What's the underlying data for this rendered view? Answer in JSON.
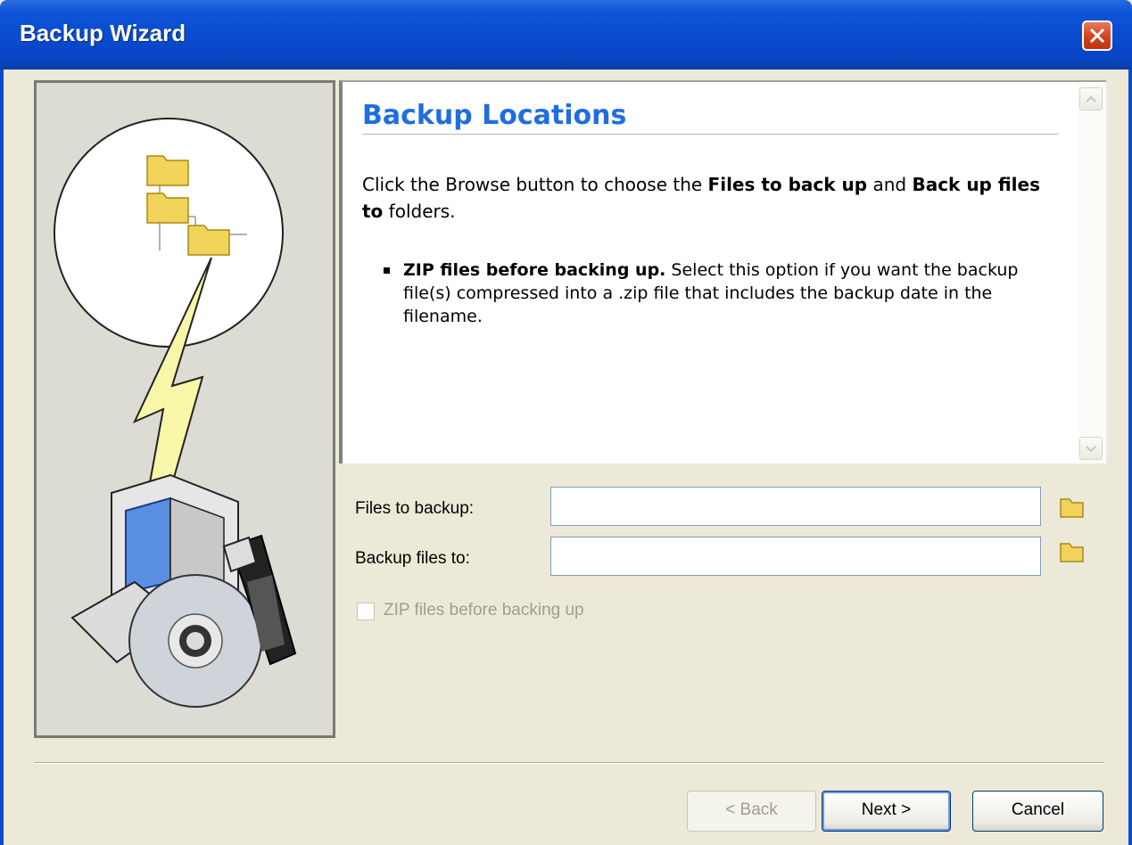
{
  "window": {
    "title": "Backup Wizard"
  },
  "description": {
    "heading": "Backup Locations",
    "intro_prefix": "Click the Browse button to choose the ",
    "intro_bold1": "Files to back up",
    "intro_mid": " and ",
    "intro_bold2": "Back up files to",
    "intro_suffix": " folders.",
    "bullet_bold": "ZIP files before backing up.",
    "bullet_text": " Select this option if you want the backup file(s) compressed into a .zip file that includes the backup date in the filename."
  },
  "form": {
    "files_to_backup_label": "Files to backup:",
    "files_to_backup_value": "",
    "backup_files_to_label": "Backup files to:",
    "backup_files_to_value": "",
    "zip_label": "ZIP files before backing up",
    "zip_checked": false,
    "zip_enabled": false
  },
  "buttons": {
    "back": "< Back",
    "next": "Next >",
    "cancel": "Cancel"
  },
  "icons": [
    "close-icon",
    "folder-icon",
    "scroll-up-arrow-icon",
    "scroll-down-arrow-icon"
  ]
}
